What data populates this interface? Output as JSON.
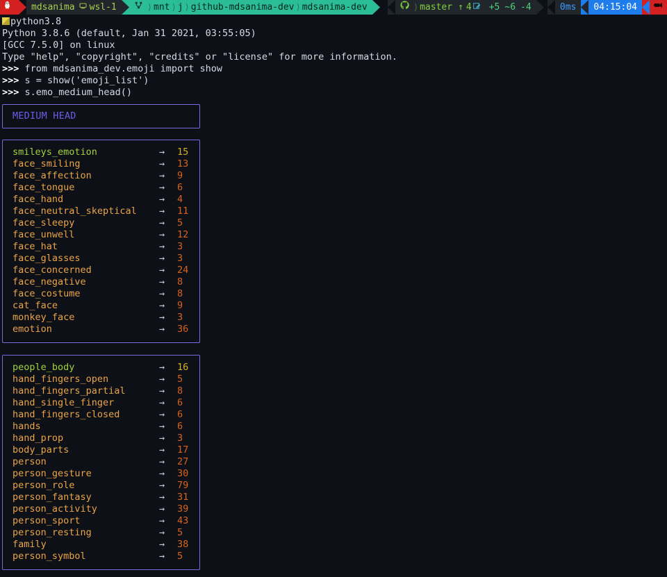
{
  "prompt_bar": {
    "user_icon": "penguin-icon",
    "user": "mdsanima",
    "host_icon": "computer-icon",
    "host": "wsl-1",
    "path_icon": "branch-icon",
    "path_segments": [
      "mnt",
      "j",
      "github-mdsanima-dev",
      "mdsanima-dev"
    ],
    "git_icon": "github-icon",
    "git_branch_icon": "branch-icon",
    "git_branch": "master",
    "git_ahead_icon": "arrow-up-icon",
    "git_ahead": "4",
    "git_staged_icon": "pencil-icon",
    "git_added": "+5",
    "git_modified": "~6",
    "git_deleted": "-4",
    "duration": "0ms",
    "clock": "04:15:04",
    "battery_icon": "plug-icon"
  },
  "terminal": {
    "command_line": "python3.8",
    "command_icon": "python-icon",
    "banner": [
      "Python 3.8.6 (default, Jan 31 2021, 03:55:05)",
      "[GCC 7.5.0] on linux",
      "Type \"help\", \"copyright\", \"credits\" or \"license\" for more information."
    ],
    "prompt_symbol": ">>>",
    "inputs": [
      "from mdsanima_dev.emoji import show",
      "s = show('emoji_list')",
      "s.emo_medium_head()"
    ]
  },
  "header_box": {
    "title": "MEDIUM HEAD"
  },
  "arrow_glyph": "→",
  "colors": {
    "background": "#0d1117",
    "box_border": "#7a6ce0",
    "header_text": "#6c5ce7",
    "label": "#eba447",
    "label_first": "#a3d13a",
    "value": "#d9631e",
    "value_first": "#d6b020",
    "arrow": "#c6ccd6"
  },
  "tables": [
    {
      "name": "smileys-emotion-table",
      "rows": [
        {
          "label": "smileys_emotion",
          "value": "15"
        },
        {
          "label": "face_smiling",
          "value": "13"
        },
        {
          "label": "face_affection",
          "value": "9"
        },
        {
          "label": "face_tongue",
          "value": "6"
        },
        {
          "label": "face_hand",
          "value": "4"
        },
        {
          "label": "face_neutral_skeptical",
          "value": "11"
        },
        {
          "label": "face_sleepy",
          "value": "5"
        },
        {
          "label": "face_unwell",
          "value": "12"
        },
        {
          "label": "face_hat",
          "value": "3"
        },
        {
          "label": "face_glasses",
          "value": "3"
        },
        {
          "label": "face_concerned",
          "value": "24"
        },
        {
          "label": "face_negative",
          "value": "8"
        },
        {
          "label": "face_costume",
          "value": "8"
        },
        {
          "label": "cat_face",
          "value": "9"
        },
        {
          "label": "monkey_face",
          "value": "3"
        },
        {
          "label": "emotion",
          "value": "36"
        }
      ]
    },
    {
      "name": "people-body-table",
      "rows": [
        {
          "label": "people_body",
          "value": "16"
        },
        {
          "label": "hand_fingers_open",
          "value": "5"
        },
        {
          "label": "hand_fingers_partial",
          "value": "8"
        },
        {
          "label": "hand_single_finger",
          "value": "6"
        },
        {
          "label": "hand_fingers_closed",
          "value": "6"
        },
        {
          "label": "hands",
          "value": "6"
        },
        {
          "label": "hand_prop",
          "value": "3"
        },
        {
          "label": "body_parts",
          "value": "17"
        },
        {
          "label": "person",
          "value": "27"
        },
        {
          "label": "person_gesture",
          "value": "30"
        },
        {
          "label": "person_role",
          "value": "79"
        },
        {
          "label": "person_fantasy",
          "value": "31"
        },
        {
          "label": "person_activity",
          "value": "39"
        },
        {
          "label": "person_sport",
          "value": "43"
        },
        {
          "label": "person_resting",
          "value": "5"
        },
        {
          "label": "family",
          "value": "38"
        },
        {
          "label": "person_symbol",
          "value": "5"
        }
      ]
    }
  ]
}
